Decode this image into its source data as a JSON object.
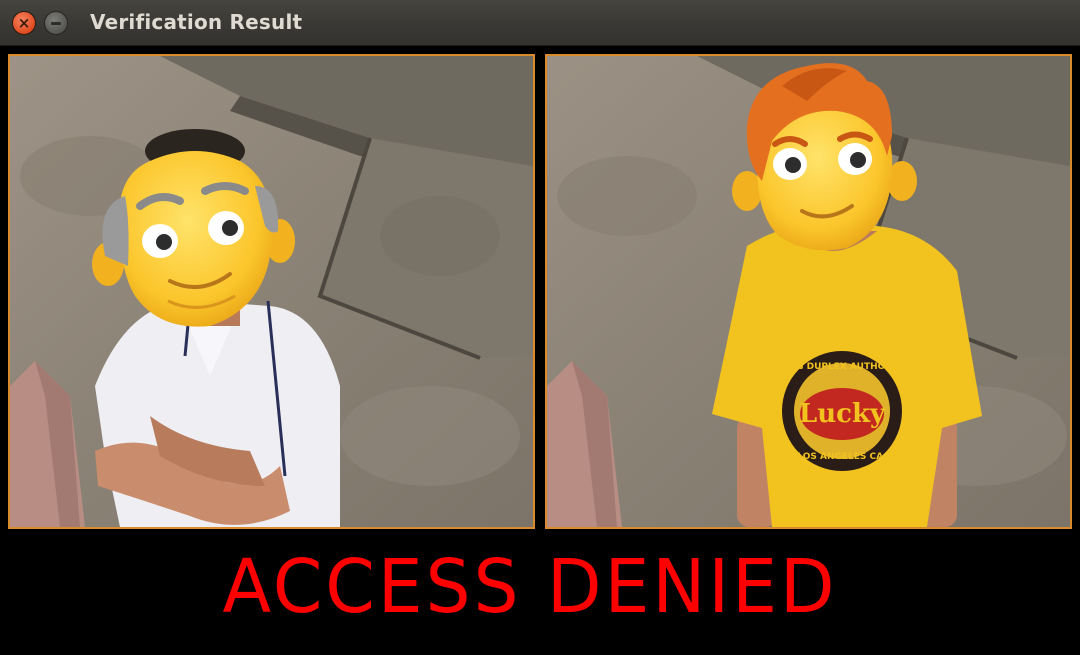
{
  "window": {
    "title": "Verification Result",
    "close_glyph": "×"
  },
  "images": [
    {
      "name": "left-capture",
      "subject": "person in white polo shirt with grandpa face emoji"
    },
    {
      "name": "right-capture",
      "subject": "person in yellow t-shirt with red-haired boy face emoji"
    }
  ],
  "shirt_logo": {
    "arc_text": "FLYING DUPLEX AUTHORIZED",
    "center_text": "Lucky",
    "bottom_text": "LOS ANGELES CA."
  },
  "result": {
    "text": "ACCESS DENIED",
    "color": "#ff0000"
  },
  "colors": {
    "panel_border": "#d98a2a",
    "close_button": "#df4b1f",
    "titlebar": "#3a3935"
  }
}
